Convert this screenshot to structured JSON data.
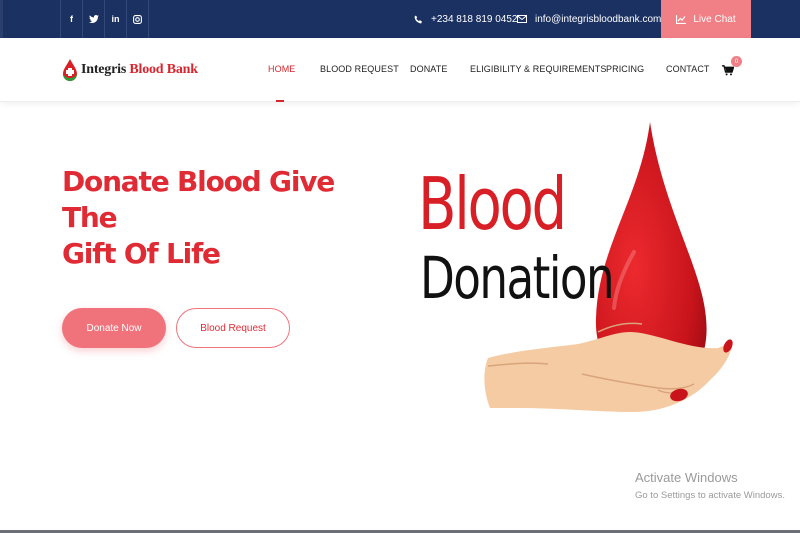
{
  "topbar": {
    "social": [
      {
        "icon": "facebook-icon",
        "glyph": "f"
      },
      {
        "icon": "twitter-icon",
        "glyph": "t"
      },
      {
        "icon": "linkedin-icon",
        "glyph": "in"
      },
      {
        "icon": "instagram-icon",
        "glyph": "o"
      }
    ],
    "phone": "+234 818 819 0452",
    "email": "info@integrisbloodbank.com",
    "live_chat": "Live Chat"
  },
  "brand": {
    "name_part1": "Integris",
    "name_part2": "Blood Bank",
    "colors": {
      "primary": "#e02b35",
      "accent": "#f0737c",
      "topbar": "#1b3162"
    }
  },
  "nav": {
    "items": [
      "HOME",
      "BLOOD REQUEST",
      "DONATE",
      "ELIGIBILITY & REQUIREMENTS",
      "PRICING",
      "CONTACT"
    ],
    "active": "HOME",
    "cart_count": "0"
  },
  "hero": {
    "title_line1": "Donate Blood Give The",
    "title_line2": "Gift Of Life",
    "primary_button": "Donate Now",
    "secondary_button": "Blood Request",
    "image_word1": "Blood",
    "image_word2": "Donation"
  },
  "watermark": {
    "line1": "Activate Windows",
    "line2": "Go to Settings to activate Windows."
  }
}
